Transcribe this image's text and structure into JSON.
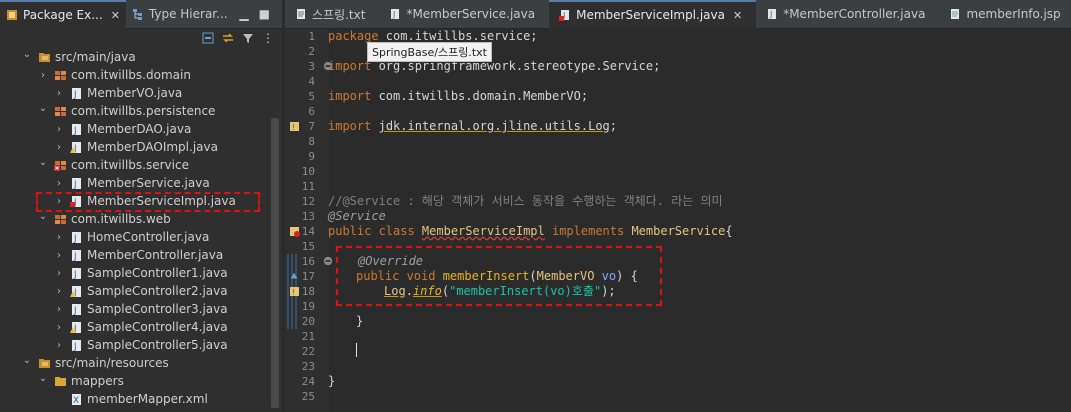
{
  "left_pane": {
    "tabs": [
      {
        "label": "Package Ex...",
        "active": true,
        "closable": true
      },
      {
        "label": "Type Hierar...",
        "active": false
      }
    ],
    "tree": [
      {
        "label": "src/main/java",
        "indent": 1,
        "chev": "v",
        "icon": "package-folder-icon"
      },
      {
        "label": "com.itwillbs.domain",
        "indent": 2,
        "chev": ">",
        "icon": "package-icon"
      },
      {
        "label": "MemberVO.java",
        "indent": 3,
        "chev": ">",
        "icon": "java-file-icon"
      },
      {
        "label": "com.itwillbs.persistence",
        "indent": 2,
        "chev": "v",
        "icon": "package-icon"
      },
      {
        "label": "MemberDAO.java",
        "indent": 3,
        "chev": ">",
        "icon": "java-file-icon"
      },
      {
        "label": "MemberDAOImpl.java",
        "indent": 3,
        "chev": ">",
        "icon": "java-file-warning-icon"
      },
      {
        "label": "com.itwillbs.service",
        "indent": 2,
        "chev": "v",
        "icon": "package-error-icon"
      },
      {
        "label": "MemberService.java",
        "indent": 3,
        "chev": ">",
        "icon": "java-file-icon"
      },
      {
        "label": "MemberServiceImpl.java",
        "indent": 3,
        "chev": ">",
        "icon": "java-file-error-icon"
      },
      {
        "label": "com.itwillbs.web",
        "indent": 2,
        "chev": "v",
        "icon": "package-icon"
      },
      {
        "label": "HomeController.java",
        "indent": 3,
        "chev": ">",
        "icon": "java-file-icon"
      },
      {
        "label": "MemberController.java",
        "indent": 3,
        "chev": ">",
        "icon": "java-file-icon"
      },
      {
        "label": "SampleController1.java",
        "indent": 3,
        "chev": ">",
        "icon": "java-file-icon"
      },
      {
        "label": "SampleController2.java",
        "indent": 3,
        "chev": ">",
        "icon": "java-file-warning-icon"
      },
      {
        "label": "SampleController3.java",
        "indent": 3,
        "chev": ">",
        "icon": "java-file-icon"
      },
      {
        "label": "SampleController4.java",
        "indent": 3,
        "chev": ">",
        "icon": "java-file-warning-icon"
      },
      {
        "label": "SampleController5.java",
        "indent": 3,
        "chev": ">",
        "icon": "java-file-icon"
      },
      {
        "label": "src/main/resources",
        "indent": 1,
        "chev": "v",
        "icon": "package-folder-icon"
      },
      {
        "label": "mappers",
        "indent": 2,
        "chev": "v",
        "icon": "folder-icon"
      },
      {
        "label": "memberMapper.xml",
        "indent": 3,
        "chev": "",
        "icon": "xml-file-icon"
      }
    ]
  },
  "editor": {
    "tabs": [
      {
        "label": "스프링.txt",
        "active": false
      },
      {
        "label": "*MemberService.java",
        "active": false
      },
      {
        "label": "MemberServiceImpl.java",
        "active": true,
        "closable": true
      },
      {
        "label": "*MemberController.java",
        "active": false
      },
      {
        "label": "memberInfo.jsp",
        "active": false
      }
    ],
    "tooltip": "SpringBase/스프링.txt",
    "line_numbers": [
      "1",
      "2",
      "3",
      "4",
      "5",
      "6",
      "7",
      "8",
      "9",
      "10",
      "11",
      "12",
      "13",
      "14",
      "15",
      "16",
      "17",
      "18",
      "19",
      "20",
      "21",
      "22",
      "23",
      "24",
      "25"
    ],
    "code": {
      "l1_kw": "package",
      "l1_rest": " com.itwillbs.service;",
      "l3_kw": "import",
      "l3_rest": " org.springframework.stereotype.Service;",
      "l5_kw": "import",
      "l5_rest": " com.itwillbs.domain.MemberVO;",
      "l7_kw": "import",
      "l7_rest": "jdk.internal.org.jline.utils.Log",
      "l7_semi": ";",
      "l12": "//@Service : 해당 객체가 서비스 동작을 수행하는 객체다. 라는 의미",
      "l13": "@Service",
      "l14_kw": "public class ",
      "l14_cls": "MemberServiceImpl",
      "l14_impl": " implements ",
      "l14_iface": "MemberService",
      "l14_brace": "{",
      "l16": "@Override",
      "l17_kw": "public void ",
      "l17_meth": "memberInsert",
      "l17_p1": "(",
      "l17_type": "MemberVO",
      "l17_param": " vo",
      "l17_p2": ") {",
      "l18_log": "Log",
      "l18_dot": ".",
      "l18_info": "info",
      "l18_p1": "(",
      "l18_str": "\"memberInsert(vo)호출\"",
      "l18_p2": ");",
      "l20": "}",
      "l24": "}"
    }
  },
  "colors": {
    "highlight_box": "#e01010",
    "accent": "#5b7ea7"
  }
}
